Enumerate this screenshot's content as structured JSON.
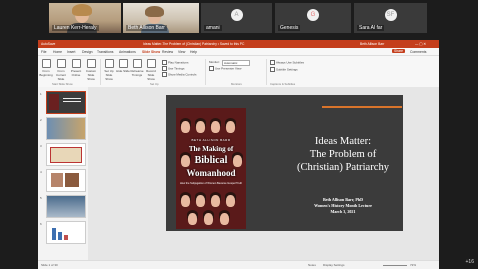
{
  "participants": [
    {
      "name": "Lauren Kerr-Heraly",
      "type": "video"
    },
    {
      "name": "Beth Allison Barr",
      "type": "video"
    },
    {
      "name": "amani",
      "type": "avatar",
      "initial": "A"
    },
    {
      "name": "Genesis",
      "type": "avatar",
      "initial": "G"
    },
    {
      "name": "Sara Al far",
      "type": "avatar",
      "initial": "SF"
    }
  ],
  "overflow_count": "+16",
  "ppt": {
    "title_left": "AutoSave",
    "title_center": "Ideas Matter-The Problem of (Christian) Patriarchy • Saved to this PC",
    "title_right": "Beth Allison Barr",
    "menu": [
      "File",
      "Home",
      "Insert",
      "Design",
      "Transitions",
      "Animations",
      "Slide Show",
      "Review",
      "View",
      "Help"
    ],
    "active_menu": "Slide Show",
    "share_label": "Share",
    "comments_label": "Comments",
    "ribbon_buttons": [
      "From Beginning",
      "From Current Slide",
      "Present Online",
      "Custom Slide Show",
      "Set Up Slide Show",
      "Hide Slide",
      "Rehearse Timings",
      "Record Slide Show"
    ],
    "ribbon_options": [
      "Play Narrations",
      "Use Timings",
      "Show Media Controls",
      "Always Use Subtitles",
      "Use Presenter View"
    ],
    "monitor_label": "Monitor:",
    "monitor_value": "Automatic",
    "subtitle_settings": "Subtitle Settings",
    "groups": [
      "Start Slide Show",
      "Set Up",
      "Monitors",
      "Captions & Subtitles"
    ],
    "slide_numbers": [
      "1",
      "2",
      "3",
      "4",
      "5",
      "6"
    ],
    "status_left": "Slide 1 of 30",
    "status_notes": "Notes",
    "status_display": "Display Settings",
    "status_zoom": "72%"
  },
  "slide": {
    "book_author": "BETH ALLISON BARR",
    "book_title_1": "The Making of",
    "book_title_2": "Biblical",
    "book_title_3": "Womanhood",
    "book_subtitle": "How the Subjugation of Women Became Gospel Truth",
    "title_line1": "Ideas Matter:",
    "title_line2": "The Problem of",
    "title_line3": "(Christian) Patriarchy",
    "meta_line1": "Beth Allison Barr, PhD",
    "meta_line2": "Women's History Month Lecture",
    "meta_line3": "March 3, 2021"
  }
}
